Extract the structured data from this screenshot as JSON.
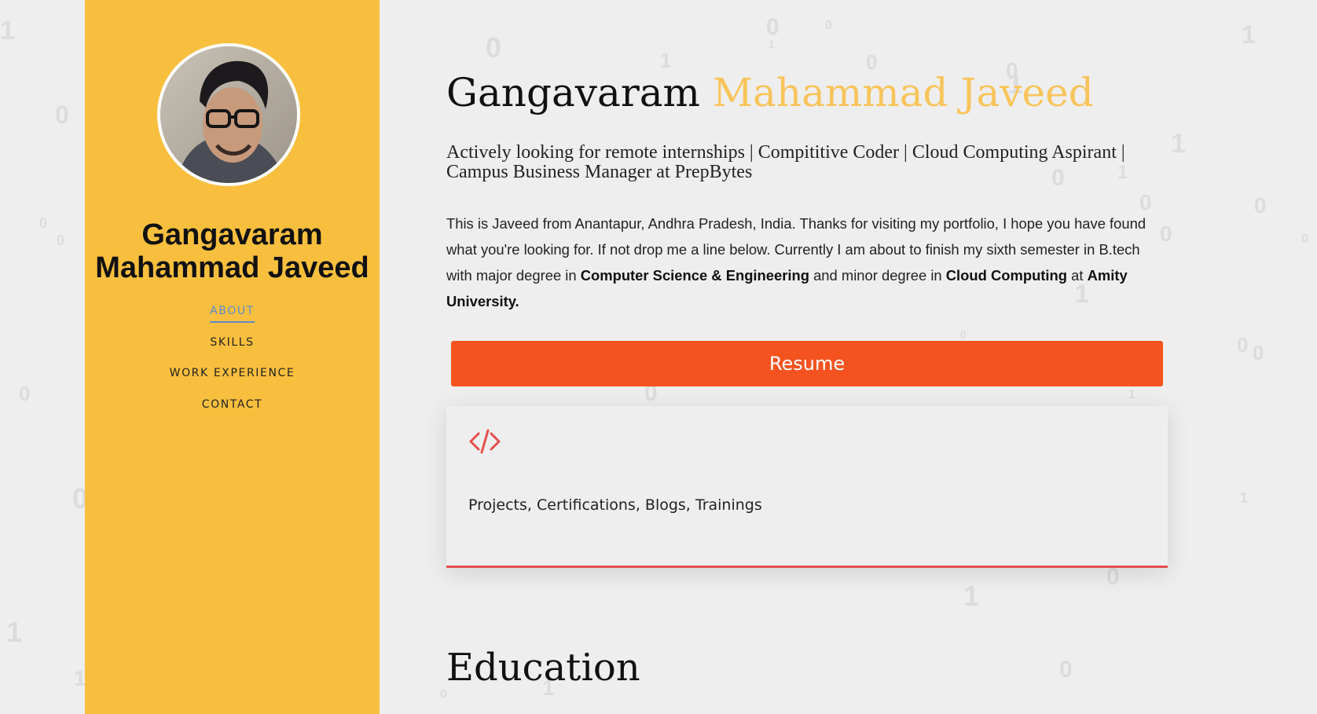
{
  "sidebar": {
    "name": "Gangavaram Mahammad Javeed",
    "nav": [
      {
        "label": "ABOUT",
        "active": true
      },
      {
        "label": "SKILLS",
        "active": false
      },
      {
        "label": "WORK EXPERIENCE",
        "active": false
      },
      {
        "label": "CONTACT",
        "active": false
      }
    ]
  },
  "main": {
    "name_first": "Gangavaram",
    "name_accent": "Mahammad Javeed",
    "headline": "Actively looking for remote internships | Compititive Coder | Cloud Computing Aspirant | Campus Business Manager at PrepBytes",
    "about": {
      "intro": "This is Javeed from Anantapur, Andhra Pradesh, India. Thanks for visiting my portfolio, I hope you have found what you're looking for. If not drop me a line below. Currently I am about to finish my sixth semester in B.tech with major degree in ",
      "major": "Computer Science & Engineering",
      "mid": " and minor degree in ",
      "minor": "Cloud Computing",
      "at": " at ",
      "university": "Amity University."
    },
    "resume_label": "Resume",
    "card": {
      "icon": "code-icon",
      "text": "Projects, Certifications, Blogs, Trainings"
    },
    "education_title": "Education"
  },
  "colors": {
    "sidebar_bg": "#f8bf3e",
    "accent_name": "#f8c45a",
    "resume_button": "#f4531f",
    "card_accent": "#e3504a",
    "nav_active": "#5b8bd0",
    "background": "#eeeeee"
  }
}
